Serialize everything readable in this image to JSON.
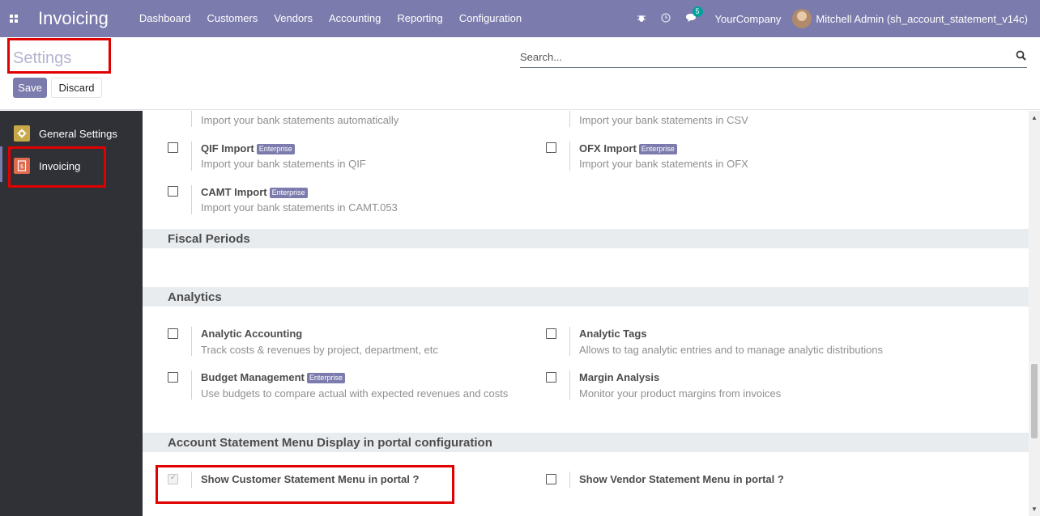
{
  "navbar": {
    "app_name": "Invoicing",
    "menu": [
      "Dashboard",
      "Customers",
      "Vendors",
      "Accounting",
      "Reporting",
      "Configuration"
    ],
    "messages_count": "5",
    "company": "YourCompany",
    "user": "Mitchell Admin (sh_account_statement_v14c)"
  },
  "control_panel": {
    "title": "Settings",
    "save_label": "Save",
    "discard_label": "Discard",
    "search_placeholder": "Search..."
  },
  "sidebar": {
    "items": [
      {
        "label": "General Settings",
        "icon": "gear-icon",
        "color": "#c9a847"
      },
      {
        "label": "Invoicing",
        "icon": "invoice-icon",
        "color": "#e06a4e"
      }
    ]
  },
  "settings": {
    "top_left_desc": "Import your bank statements automatically",
    "top_right_desc": "Import your bank statements in CSV",
    "qif": {
      "title": "QIF Import",
      "badge": "Enterprise",
      "desc": "Import your bank statements in QIF",
      "checked": false
    },
    "ofx": {
      "title": "OFX Import",
      "badge": "Enterprise",
      "desc": "Import your bank statements in OFX",
      "checked": false
    },
    "camt": {
      "title": "CAMT Import",
      "badge": "Enterprise",
      "desc": "Import your bank statements in CAMT.053",
      "checked": false
    },
    "fiscal_periods": "Fiscal Periods",
    "analytics": "Analytics",
    "analytic_accounting": {
      "title": "Analytic Accounting",
      "desc": "Track costs & revenues by project, department, etc",
      "checked": false
    },
    "analytic_tags": {
      "title": "Analytic Tags",
      "desc": "Allows to tag analytic entries and to manage analytic distributions",
      "checked": false
    },
    "budget": {
      "title": "Budget Management",
      "badge": "Enterprise",
      "desc": "Use budgets to compare actual with expected revenues and costs",
      "checked": false
    },
    "margin": {
      "title": "Margin Analysis",
      "desc": "Monitor your product margins from invoices",
      "checked": false
    },
    "account_statement": "Account Statement Menu Display in portal configuration",
    "customer_statement": {
      "title": "Show Customer Statement Menu in portal ?",
      "checked": true
    },
    "vendor_statement": {
      "title": "Show Vendor Statement Menu in portal ?",
      "checked": false
    }
  },
  "colors": {
    "brand": "#7c7bad",
    "highlight": "#e00000",
    "sidebar_bg": "#2f3136"
  }
}
